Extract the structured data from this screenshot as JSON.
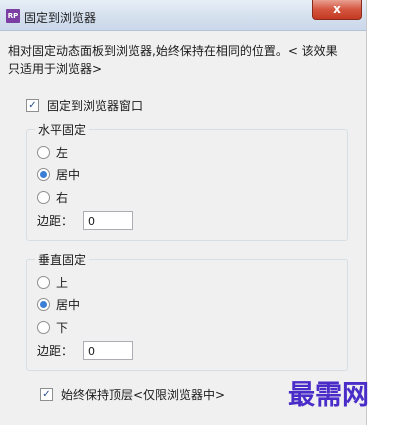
{
  "window": {
    "title": "固定到浏览器",
    "app_icon_text": "RP",
    "close_symbol": "x"
  },
  "description": "相对固定动态面板到浏览器,始终保持在相同的位置。< 该效果只适用于浏览器>",
  "pin_checkbox": {
    "label": "固定到浏览器窗口",
    "checked": true
  },
  "horizontal": {
    "title": "水平固定",
    "options": [
      "左",
      "居中",
      "右"
    ],
    "selected": "居中",
    "margin_label": "边距：",
    "margin_value": "0"
  },
  "vertical": {
    "title": "垂直固定",
    "options": [
      "上",
      "居中",
      "下"
    ],
    "selected": "居中",
    "margin_label": "边距：",
    "margin_value": "0"
  },
  "top_checkbox": {
    "label": "始终保持顶层<仅限浏览器中>",
    "checked": true
  },
  "watermark": "最需网"
}
